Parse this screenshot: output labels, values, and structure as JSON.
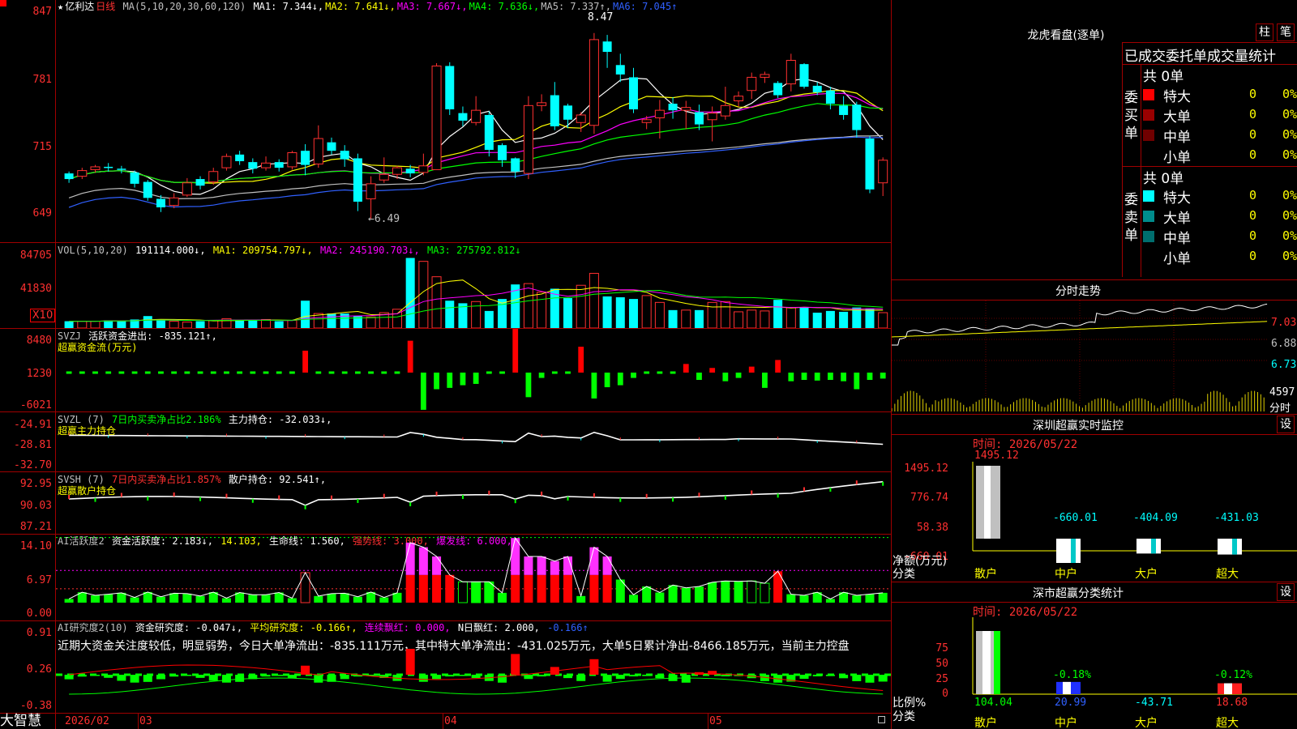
{
  "app": {
    "bottom_brand": "大智慧"
  },
  "main": {
    "title": {
      "star": "★",
      "stock": "亿利达",
      "period": "日线",
      "ma_params": "MA(5,10,20,30,60,120)",
      "mas": [
        {
          "label": "MA1: 7.344↓,",
          "color": "#ffffff"
        },
        {
          "label": "MA2: 7.641↓,",
          "color": "#ffff00"
        },
        {
          "label": "MA3: 7.667↓,",
          "color": "#ff00ff"
        },
        {
          "label": "MA4: 7.636↓,",
          "color": "#00ff00"
        },
        {
          "label": "MA5: 7.337↑,",
          "color": "#c0c0c0"
        },
        {
          "label": "MA6: 7.045↑",
          "color": "#3060ff"
        }
      ]
    },
    "y_ticks": [
      "847",
      "781",
      "715",
      "649"
    ],
    "high_label": "8.47",
    "low_label": "←6.49",
    "candles": [
      [
        6.98,
        6.92,
        7.0,
        6.88
      ],
      [
        6.95,
        7.01,
        7.04,
        6.92
      ],
      [
        7.02,
        7.05,
        7.07,
        6.99
      ],
      [
        7.05,
        7.04,
        7.09,
        7.0
      ],
      [
        7.03,
        7.02,
        7.06,
        6.98
      ],
      [
        6.99,
        6.87,
        7.01,
        6.83
      ],
      [
        6.89,
        6.72,
        6.91,
        6.69
      ],
      [
        6.71,
        6.62,
        6.75,
        6.57
      ],
      [
        6.64,
        6.72,
        6.77,
        6.61
      ],
      [
        6.75,
        6.88,
        6.93,
        6.73
      ],
      [
        6.92,
        6.85,
        6.95,
        6.81
      ],
      [
        6.89,
        7.0,
        7.04,
        6.86
      ],
      [
        7.04,
        7.16,
        7.19,
        7.01
      ],
      [
        7.18,
        7.11,
        7.22,
        7.07
      ],
      [
        7.1,
        7.03,
        7.14,
        6.98
      ],
      [
        7.04,
        7.09,
        7.16,
        7.01
      ],
      [
        7.1,
        7.04,
        7.13,
        7.0
      ],
      [
        7.05,
        7.2,
        7.22,
        7.02
      ],
      [
        7.22,
        7.07,
        7.29,
        6.96
      ],
      [
        7.08,
        7.35,
        7.49,
        7.04
      ],
      [
        7.31,
        7.22,
        7.36,
        7.18
      ],
      [
        7.22,
        7.13,
        7.28,
        7.05
      ],
      [
        7.14,
        6.68,
        7.19,
        6.58
      ],
      [
        6.71,
        6.87,
        6.95,
        6.49
      ],
      [
        6.91,
        6.97,
        7.15,
        6.88
      ],
      [
        6.97,
        7.04,
        7.06,
        6.92
      ],
      [
        7.03,
        6.98,
        7.07,
        6.94
      ],
      [
        6.99,
        7.06,
        7.19,
        6.96
      ],
      [
        7.02,
        8.12,
        8.15,
        7.02
      ],
      [
        8.12,
        7.66,
        8.16,
        7.6
      ],
      [
        7.62,
        7.54,
        7.69,
        7.48
      ],
      [
        7.52,
        7.65,
        7.8,
        7.49
      ],
      [
        7.6,
        7.23,
        7.64,
        7.16
      ],
      [
        7.28,
        7.12,
        7.3,
        7.05
      ],
      [
        7.14,
        7.0,
        7.15,
        6.93
      ],
      [
        6.98,
        7.7,
        7.8,
        6.92
      ],
      [
        7.7,
        7.73,
        7.82,
        7.64
      ],
      [
        7.81,
        7.48,
        7.95,
        7.44
      ],
      [
        7.7,
        7.55,
        7.72,
        7.46
      ],
      [
        7.52,
        7.6,
        7.63,
        7.42
      ],
      [
        7.49,
        8.4,
        8.47,
        7.4
      ],
      [
        8.38,
        8.27,
        8.45,
        8.1
      ],
      [
        8.13,
        8.03,
        8.25,
        7.95
      ],
      [
        8.0,
        7.66,
        8.1,
        7.62
      ],
      [
        7.52,
        7.55,
        7.59,
        7.45
      ],
      [
        7.57,
        7.65,
        7.76,
        7.35
      ],
      [
        7.72,
        7.65,
        7.79,
        7.56
      ],
      [
        7.65,
        7.68,
        7.75,
        7.45
      ],
      [
        7.63,
        7.5,
        7.71,
        7.44
      ],
      [
        7.55,
        7.62,
        7.69,
        7.32
      ],
      [
        7.59,
        7.7,
        7.9,
        7.55
      ],
      [
        7.75,
        7.8,
        7.85,
        7.69
      ],
      [
        7.86,
        8.0,
        8.05,
        7.77
      ],
      [
        8.0,
        8.03,
        8.06,
        7.94
      ],
      [
        7.94,
        7.81,
        7.96,
        7.78
      ],
      [
        7.93,
        8.18,
        8.25,
        7.85
      ],
      [
        8.14,
        7.9,
        8.15,
        7.88
      ],
      [
        7.91,
        7.84,
        7.95,
        7.81
      ],
      [
        7.86,
        7.72,
        7.9,
        7.66
      ],
      [
        7.7,
        7.6,
        7.8,
        7.55
      ],
      [
        7.71,
        7.44,
        7.74,
        7.36
      ],
      [
        7.35,
        6.81,
        7.38,
        6.77
      ],
      [
        6.88,
        7.12,
        7.15,
        6.74
      ]
    ]
  },
  "vol": {
    "title": {
      "params": "VOL(5,10,20)",
      "value": "191114.000↓,",
      "ma1": "MA1: 209754.797↓,",
      "ma2": "MA2: 245190.703↓,",
      "ma3": "MA3: 275792.812↓"
    },
    "y_ticks": [
      "84705",
      "41830"
    ],
    "unit": "X10",
    "values": [
      8,
      8,
      8,
      9,
      8,
      10,
      14,
      10,
      8,
      7,
      8,
      9,
      11,
      9,
      9,
      10,
      8,
      9,
      32,
      17,
      17,
      17,
      14,
      13,
      18,
      22,
      82,
      78,
      60,
      32,
      29,
      31,
      20,
      34,
      51,
      52,
      42,
      46,
      35,
      50,
      64,
      37,
      36,
      34,
      38,
      30,
      21,
      21,
      21,
      30,
      31,
      19,
      21,
      20,
      33,
      24,
      24,
      18,
      20,
      19,
      24,
      23,
      18
    ]
  },
  "svzj": {
    "title": {
      "name": "SVZJ",
      "label": "活跃资金进出: -835.121↑,",
      "sub": "超赢资金流(万元)"
    },
    "y_ticks": [
      "8480",
      "1230",
      "-6021"
    ],
    "values": [
      0.5,
      0.3,
      0.2,
      0.4,
      0.3,
      -0.3,
      -0.5,
      0.3,
      0.6,
      -0.2,
      0.3,
      0.2,
      0.4,
      0.2,
      0.5,
      0.3,
      0.4,
      0.3,
      3.3,
      -0.4,
      0.2,
      0.3,
      0.4,
      0.2,
      0.4,
      0.3,
      4.8,
      -5.6,
      -2.5,
      -2.3,
      -1.9,
      -1.7,
      0.3,
      0.4,
      6.8,
      -3.7,
      -0.8,
      0.3,
      0.4,
      3.9,
      -3.9,
      -2.2,
      -1.9,
      -0.8,
      0.3,
      0.2,
      -0.3,
      1.3,
      -1.1,
      0.7,
      -1.3,
      -0.8,
      0.9,
      -2.3,
      1.9,
      -1.3,
      -1.1,
      -1.2,
      -1.1,
      -1.3,
      -2.5,
      -1.1,
      -0.9
    ]
  },
  "svzl": {
    "title": {
      "name": "SVZL (7)",
      "pct": "7日内买卖净占比2.186%",
      "label": "主力持仓: -32.033↓,",
      "sub": "超赢主力持仓"
    },
    "y_ticks": [
      "-24.91",
      "-28.81",
      "-32.70"
    ]
  },
  "svsh": {
    "title": {
      "name": "SVSH (7)",
      "pct": "7日内买卖净占比1.857%",
      "label": "散户持仓: 92.541↑,",
      "sub": "超赢散户持仓"
    },
    "y_ticks": [
      "92.95",
      "90.03",
      "87.21"
    ]
  },
  "ai1": {
    "title": {
      "name": "AI活跃度2",
      "label": "资金活跃度: 2.183↓,",
      "v2": "14.103,",
      "life": "生命线: 1.560,",
      "strong": "强势线: 3.000,",
      "burst": "爆发线: 6.000,"
    },
    "y_ticks": [
      "14.10",
      "6.97",
      "0.00"
    ]
  },
  "ai2": {
    "title": {
      "name": "AI研究度2(10)",
      "label": "资金研究度: -0.047↓,",
      "avg": "平均研究度: -0.166↑,",
      "lian": "连续飘红: 0.000,",
      "n": "N日飘红: 2.000,",
      "v": "-0.166↑"
    },
    "y_ticks": [
      "0.91",
      "0.26",
      "-0.38"
    ],
    "desc": "近期大资金关注度较低，明显弱势，今日大单净流出：-835.111万元，其中特大单净流出：-431.025万元，大单5日累计净出-8466.185万元，当前主力控盘"
  },
  "x_axis": {
    "labels": [
      "2026/02",
      "03",
      "04",
      "05"
    ]
  },
  "right": {
    "lh_title": "龙虎看盘(逐单)",
    "btn_zhu": "柱",
    "btn_bi": "笔",
    "table_header": "已成交委托单成交量统计",
    "buy": {
      "side": "委买单",
      "total": "共 0单",
      "rows": [
        {
          "label": "特大",
          "color": "#ff0000",
          "v": "0",
          "p": "0%"
        },
        {
          "label": "大单",
          "color": "#9a0000",
          "v": "0",
          "p": "0%"
        },
        {
          "label": "中单",
          "color": "#700000",
          "v": "0",
          "p": "0%"
        },
        {
          "label": "小单",
          "color": "#000000",
          "v": "0",
          "p": "0%"
        }
      ]
    },
    "sell": {
      "side": "委卖单",
      "total": "共 0单",
      "rows": [
        {
          "label": "特大",
          "color": "#00ffff",
          "v": "0",
          "p": "0%"
        },
        {
          "label": "大单",
          "color": "#008c8c",
          "v": "0",
          "p": "0%"
        },
        {
          "label": "中单",
          "color": "#006e6e",
          "v": "0",
          "p": "0%"
        },
        {
          "label": "小单",
          "color": "#000000",
          "v": "0",
          "p": "0%"
        }
      ]
    },
    "intraday": {
      "title": "分时走势",
      "y": [
        "7.03",
        "6.88",
        "6.73"
      ],
      "vol": "4597",
      "vol_unit": "分时"
    },
    "sz_monitor": {
      "title": "深圳超赢实时监控",
      "btn": "设",
      "time": "时间: 2026/05/22",
      "y": [
        "1495.12",
        "776.74",
        "58.38",
        "-660.01"
      ],
      "bars": [
        {
          "cat": "散户",
          "value": 1495.12,
          "label": "1495.12"
        },
        {
          "cat": "中户",
          "value": -660.01,
          "label": "-660.01"
        },
        {
          "cat": "大户",
          "value": -404.09,
          "label": "-404.09"
        },
        {
          "cat": "超大",
          "value": -431.03,
          "label": "-431.03"
        }
      ],
      "ylabel": "净额(万元)",
      "xlabel": "分类"
    },
    "sz_class": {
      "title": "深市超赢分类统计",
      "btn": "设",
      "time": "时间: 2026/05/22",
      "y": [
        "75",
        "50",
        "25",
        "0"
      ],
      "bars": [
        {
          "cat": "散户",
          "value": 104.04,
          "label": "104.04",
          "pct": ""
        },
        {
          "cat": "中户",
          "value": 20.99,
          "label": "20.99",
          "pct": "-0.18%"
        },
        {
          "cat": "大户",
          "value": -43.71,
          "label": "-43.71",
          "pct": ""
        },
        {
          "cat": "超大",
          "value": 18.68,
          "label": "18.68",
          "pct": "-0.12%"
        }
      ],
      "ylabel": "比例%",
      "xlabel": "分类"
    }
  }
}
